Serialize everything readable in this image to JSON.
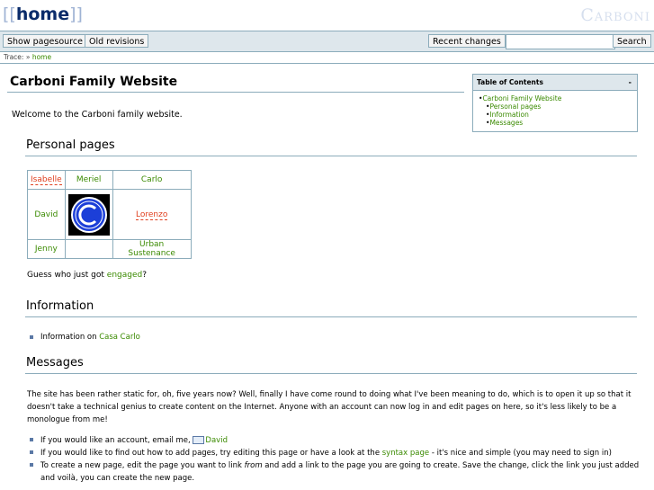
{
  "header": {
    "page_id_open": "[[",
    "page_id": "home",
    "page_id_close": "]]",
    "site_title": "Carboni"
  },
  "toolbar": {
    "show_pagesource": "Show pagesource",
    "old_revisions": "Old revisions",
    "recent_changes": "Recent changes",
    "search_value": "",
    "search_button": "Search"
  },
  "trace": {
    "label": "Trace:",
    "separator": "»",
    "item": "home"
  },
  "main": {
    "title": "Carboni Family Website",
    "intro": "Welcome to the Carboni family website."
  },
  "toc": {
    "title": "Table of Contents",
    "toggle": "-",
    "items": [
      {
        "label": "Carboni Family Website"
      },
      {
        "label": "Personal pages"
      },
      {
        "label": "Information"
      },
      {
        "label": "Messages"
      }
    ]
  },
  "personal": {
    "heading": "Personal pages",
    "table": {
      "r1": [
        "Isabelle",
        "Meriel",
        "Carlo"
      ],
      "r2": [
        "David",
        "",
        "Lorenzo"
      ],
      "r3": [
        "Jenny",
        "",
        "Urban Sustenance"
      ]
    },
    "guess_prefix": "Guess who just got",
    "guess_link": "engaged",
    "guess_suffix": "?"
  },
  "information": {
    "heading": "Information",
    "item_prefix": "Information on",
    "item_link": "Casa Carlo"
  },
  "messages": {
    "heading": "Messages",
    "paragraph": "The site has been rather static for, oh, five years now? Well, finally I have come round to doing what I've been meaning to do, which is to open it up so that it doesn't take a technical genius to create content on the Internet. Anyone with an account can now log in and edit pages on here, so it's less likely to be a monologue from me!",
    "item1_prefix": "If you would like an account, email me,",
    "item1_link": "David",
    "item2_prefix": "If you would like to find out how to add pages, try editing this page or have a look at the",
    "item2_link": "syntax page",
    "item2_suffix": "- it's nice and simple (you may need to sign in)",
    "item3_a": "To create a new page, edit the page you want to link",
    "item3_em": "from",
    "item3_b": "and add a link to the page you are going to create. Save the change, click the link you just added and voilà, you can create the new page."
  },
  "colors": {
    "link": "#3a8a00",
    "missing_link": "#e0401f",
    "rule": "#8cacbb",
    "toolbar_bg": "#dee7ec"
  }
}
